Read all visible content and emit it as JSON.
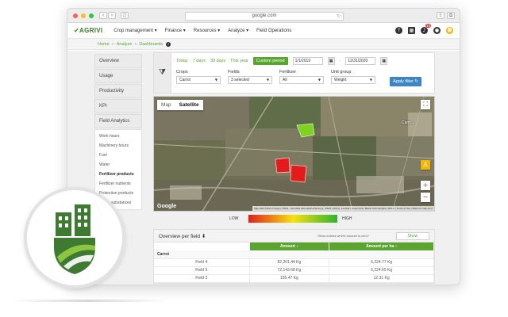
{
  "browser": {
    "url": "google.com"
  },
  "header": {
    "logo": "AGRIVI",
    "menu": [
      "Crop management ▾",
      "Finance ▾",
      "Resources ▾",
      "Analyze ▾",
      "Field Operations"
    ],
    "notification_count": "10"
  },
  "breadcrumb": {
    "items": [
      "Home",
      "Analyze",
      "Dashboards"
    ]
  },
  "sidebar": {
    "items": [
      "Overview",
      "Usage",
      "Productivity",
      "KPI",
      "Field Analytics"
    ],
    "subitems": [
      "Work hours",
      "Machinery hours",
      "Fuel",
      "Water",
      "Fertilizer products",
      "Fertilizer nutrients",
      "Protection products",
      "Active substances"
    ],
    "active_subitem": "Fertilizer products"
  },
  "filters": {
    "periods": [
      "Today",
      "7 days",
      "30 days",
      "This year",
      "Custom period"
    ],
    "active_period": "Custom period",
    "date_from": "1/1/2019",
    "date_to": "12/31/2020",
    "crops_label": "Crops",
    "crops_value": "Carrot",
    "fields_label": "Fields",
    "fields_value": "3 selected",
    "fertilizer_label": "Fertilizer",
    "fertilizer_value": "All",
    "unit_label": "Unit group",
    "unit_value": "Weight",
    "apply_label": "Apply filter ↻"
  },
  "map": {
    "tab_map": "Map",
    "tab_satellite": "Satellite",
    "google": "Google",
    "town": "Carn...",
    "attribution": "Map data ©2021 Imagery ©2021 , Aerodata International Surveys, CNES / Airbus, Landsat / Copernicus, Maxar Technologies | 200 m | Terms of Use | Report a map error"
  },
  "legend": {
    "low": "LOW",
    "high": "HIGH",
    "colors": [
      "#e21d1d",
      "#f6e20e",
      "#2fb42f"
    ]
  },
  "overview": {
    "title": "Overview per field ⬇",
    "question": "Show entries where amount is zero?",
    "show_label": "Show",
    "col_amount": "Amount ↕",
    "col_amount_ha": "Amount per ha ↕",
    "group": "Carrot",
    "rows": [
      {
        "field": "Field 4",
        "amount": "82,201.44 Kg",
        "per_ha": "6,224.77 Kg"
      },
      {
        "field": "Field 5",
        "amount": "72,143.68 Kg",
        "per_ha": "6,224.65 Kg"
      },
      {
        "field": "Field 3",
        "amount": "155.47 Kg",
        "per_ha": "12.31 Kg"
      }
    ]
  },
  "colors": {
    "brand_green": "#5aa531",
    "logo_dark_green": "#2f6b2a",
    "apply_blue": "#3d86c6"
  }
}
